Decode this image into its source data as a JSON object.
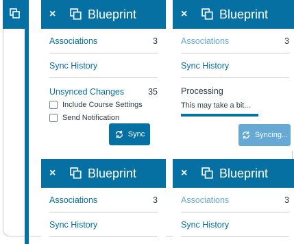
{
  "brand_color": "#0770a3",
  "panel": {
    "close_label": "×",
    "title": "Blueprint",
    "associations_label": "Associations",
    "associations_count": "3",
    "sync_history_label": "Sync History",
    "unsynced_label": "Unsynced Changes",
    "unsynced_count": "35",
    "include_settings_label": "Include Course Settings",
    "send_notification_label": "Send Notification",
    "sync_button_label": "Sync",
    "processing_label": "Processing",
    "processing_subtext": "This may take a bit...",
    "syncing_button_label": "Syncing...",
    "progress_fraction": 0.75
  }
}
